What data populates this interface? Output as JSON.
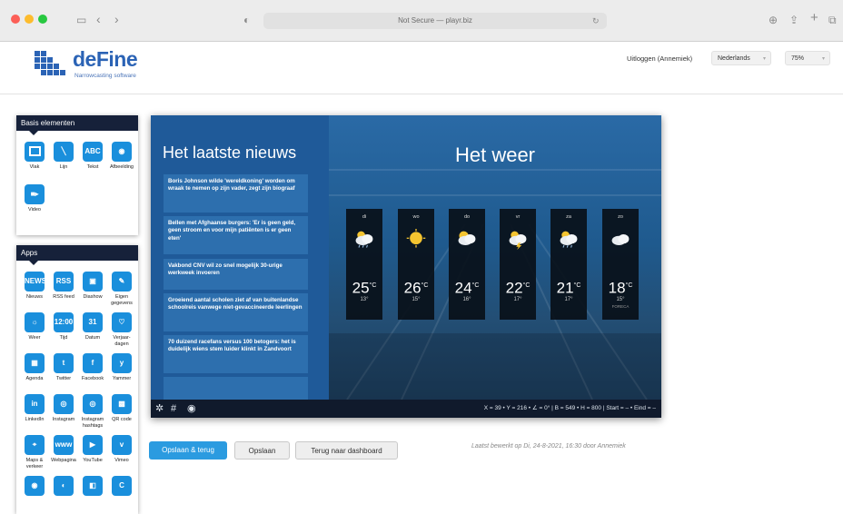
{
  "browser": {
    "url": "Not Secure — playr.biz"
  },
  "header": {
    "logo_name": "deFine",
    "logo_tagline": "Narrowcasting software",
    "logout": "Uitloggen (Annemiek)",
    "language": "Nederlands",
    "zoom": "75%"
  },
  "basis": {
    "title": "Basis elementen",
    "items": [
      {
        "label": "Vlak",
        "icon": "rectangle-icon"
      },
      {
        "label": "Lijn",
        "icon": "line-icon"
      },
      {
        "label": "Tekst",
        "icon": "text-icon",
        "glyph": "ABC"
      },
      {
        "label": "Afbeelding",
        "icon": "camera-icon"
      },
      {
        "label": "Video",
        "icon": "video-icon"
      }
    ]
  },
  "apps": {
    "title": "Apps",
    "items": [
      {
        "label": "Nieuws",
        "glyph": "NEWS"
      },
      {
        "label": "RSS feed",
        "glyph": "RSS"
      },
      {
        "label": "Diashow",
        "glyph": "▣"
      },
      {
        "label": "Eigen gegevens",
        "glyph": "✎"
      },
      {
        "label": "Weer",
        "glyph": "☼"
      },
      {
        "label": "Tijd",
        "glyph": "12:00"
      },
      {
        "label": "Datum",
        "glyph": "31"
      },
      {
        "label": "Verjaar-dagen",
        "glyph": "♡"
      },
      {
        "label": "Agenda",
        "glyph": "▦"
      },
      {
        "label": "Twitter",
        "glyph": "t"
      },
      {
        "label": "Facebook",
        "glyph": "f"
      },
      {
        "label": "Yammer",
        "glyph": "y"
      },
      {
        "label": "LinkedIn",
        "glyph": "in"
      },
      {
        "label": "Instagram",
        "glyph": "◎"
      },
      {
        "label": "Instagram hashtags",
        "glyph": "◎"
      },
      {
        "label": "QR code",
        "glyph": "▩"
      },
      {
        "label": "Maps & verkeer",
        "glyph": "⌖"
      },
      {
        "label": "Webpagina",
        "glyph": "www"
      },
      {
        "label": "YouTube",
        "glyph": "▶"
      },
      {
        "label": "Vimeo",
        "glyph": "v"
      },
      {
        "label": "",
        "glyph": "◉"
      },
      {
        "label": "",
        "glyph": "◐"
      },
      {
        "label": "",
        "glyph": "◧"
      },
      {
        "label": "",
        "glyph": "C"
      }
    ]
  },
  "news": {
    "title": "Het laatste nieuws",
    "items": [
      "Boris Johnson wilde 'wereldkoning' worden om wraak te nemen op zijn vader, zegt zijn biograaf",
      "Bellen met Afghaanse burgers: 'Er is geen geld, geen stroom en voor mijn patiënten is er geen eten'",
      "Vakbond CNV wil zo snel mogelijk 30-urige werkweek invoeren",
      "Groeiend aantal scholen ziet af van buitenlandse schoolreis vanwege niet-gevaccineerde leerlingen",
      "70 duizend racefans versus 100 betogers: het is duidelijk wiens stem luider klinkt in Zandvoort"
    ]
  },
  "weather": {
    "title": "Het weer",
    "days": [
      {
        "name": "di",
        "hi": "25",
        "lo": "13°",
        "icon": "rain-cloud-icon"
      },
      {
        "name": "wo",
        "hi": "26",
        "lo": "15°",
        "icon": "sun-icon"
      },
      {
        "name": "do",
        "hi": "24",
        "lo": "16°",
        "icon": "partly-cloudy-icon"
      },
      {
        "name": "vr",
        "hi": "22",
        "lo": "17°",
        "icon": "thunder-cloud-icon"
      },
      {
        "name": "za",
        "hi": "21",
        "lo": "17°",
        "icon": "rain-cloud-icon"
      },
      {
        "name": "zo",
        "hi": "18",
        "lo": "15°",
        "icon": "cloud-icon",
        "source": "FORECA"
      }
    ],
    "unit": "°C"
  },
  "statusbar": {
    "coords": "X = 39  •  Y = 216  •  ∠ = 0°  |  B = 549  •  H = 800  |  Start = –  •  Eind = –"
  },
  "actions": {
    "save_back": "Opslaan & terug",
    "save": "Opslaan",
    "dashboard": "Terug naar dashboard",
    "last_edit": "Laatst bewerkt op Di, 24-8-2021, 16:30 door Annemiek"
  }
}
